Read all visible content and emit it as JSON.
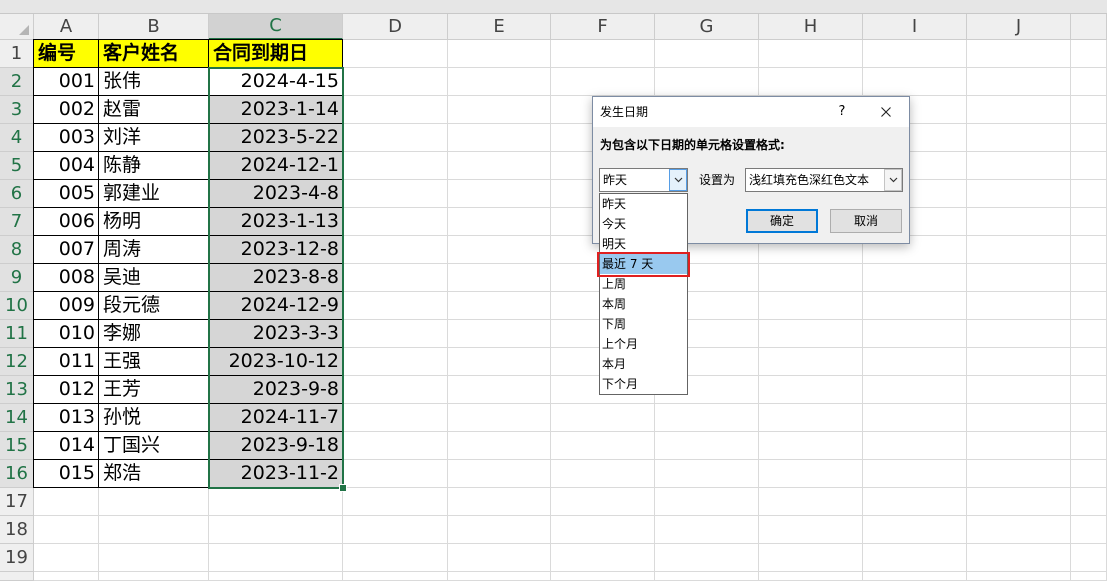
{
  "sheet": {
    "corner_icon": "select-all-triangle-icon",
    "columns": [
      "A",
      "B",
      "C",
      "D",
      "E",
      "F",
      "G",
      "H",
      "I",
      "J"
    ],
    "rows": [
      "1",
      "2",
      "3",
      "4",
      "5",
      "6",
      "7",
      "8",
      "9",
      "10",
      "11",
      "12",
      "13",
      "14",
      "15",
      "16",
      "17",
      "18",
      "19"
    ],
    "header": {
      "id": "编号",
      "name": "客户姓名",
      "due_date": "合同到期日"
    },
    "records": [
      {
        "id": "001",
        "name": "张伟",
        "due": "2024-4-15"
      },
      {
        "id": "002",
        "name": "赵雷",
        "due": "2023-1-14"
      },
      {
        "id": "003",
        "name": "刘洋",
        "due": "2023-5-22"
      },
      {
        "id": "004",
        "name": "陈静",
        "due": "2024-12-1"
      },
      {
        "id": "005",
        "name": "郭建业",
        "due": "2023-4-8"
      },
      {
        "id": "006",
        "name": "杨明",
        "due": "2023-1-13"
      },
      {
        "id": "007",
        "name": "周涛",
        "due": "2023-12-8"
      },
      {
        "id": "008",
        "name": "吴迪",
        "due": "2023-8-8"
      },
      {
        "id": "009",
        "name": "段元德",
        "due": "2024-12-9"
      },
      {
        "id": "010",
        "name": "李娜",
        "due": "2023-3-3"
      },
      {
        "id": "011",
        "name": "王强",
        "due": "2023-10-12"
      },
      {
        "id": "012",
        "name": "王芳",
        "due": "2023-9-8"
      },
      {
        "id": "013",
        "name": "孙悦",
        "due": "2024-11-7"
      },
      {
        "id": "014",
        "name": "丁国兴",
        "due": "2023-9-18"
      },
      {
        "id": "015",
        "name": "郑浩",
        "due": "2023-11-2"
      }
    ],
    "selection": {
      "column_index": 2,
      "first_row": 2,
      "last_row": 16
    }
  },
  "dialog": {
    "title": "发生日期",
    "help_label": "?",
    "close_icon": "close-icon",
    "prompt": "为包含以下日期的单元格设置格式:",
    "date_select": {
      "value": "昨天",
      "arrow_icon": "chevron-down-icon"
    },
    "set_as_label": "设置为",
    "format_select": {
      "value": "浅红填充色深红色文本",
      "arrow_icon": "chevron-down-icon"
    },
    "ok_label": "确定",
    "cancel_label": "取消"
  },
  "dropdown": {
    "items": [
      "昨天",
      "今天",
      "明天",
      "最近 7 天",
      "上周",
      "本周",
      "下周",
      "上个月",
      "本月",
      "下个月"
    ],
    "highlighted_index": 3
  },
  "colors": {
    "accent": "#217346",
    "header_fill": "#FFFF00",
    "selected_cell_fill": "#D6D6D6",
    "list_highlight": "#99C9EF",
    "annotation": "#E02020",
    "table_border": "#000000"
  }
}
